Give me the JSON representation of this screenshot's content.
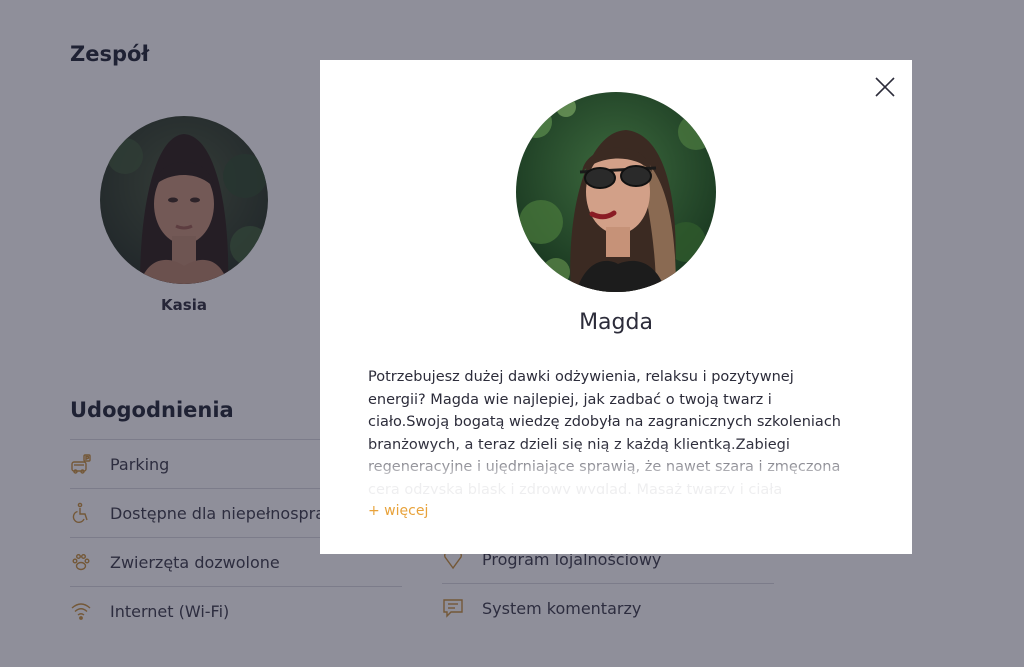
{
  "team": {
    "title": "Zespół",
    "members": [
      {
        "name": "Kasia"
      }
    ]
  },
  "amenities": {
    "title": "Udogodnienia",
    "left": [
      {
        "label": "Parking",
        "icon": "parking-icon"
      },
      {
        "label": "Dostępne dla niepełnosprawnych",
        "icon": "wheelchair-icon"
      },
      {
        "label": "Zwierzęta dozwolone",
        "icon": "paw-icon"
      },
      {
        "label": "Internet (Wi-Fi)",
        "icon": "wifi-icon"
      }
    ],
    "right": [
      {
        "label": "Program lojalnościowy",
        "icon": "heart-icon"
      },
      {
        "label": "System komentarzy",
        "icon": "comment-icon"
      }
    ]
  },
  "modal": {
    "name": "Magda",
    "bio": "Potrzebujesz dużej dawki odżywienia, relaksu i pozytywnej energii? Magda wie najlepiej, jak zadbać o twoją twarz i ciało.Swoją bogatą wiedzę zdobyła na zagranicznych szkoleniach branżowych, a teraz dzieli się nią z każdą klientką.Zabiegi regeneracyjne i ujędrniające sprawią, że nawet szara i zmęczona cera odzyska blask i zdrowy wygląd. Masaż twarzy i ciała wykonany przez Magdę jest doskonały i",
    "more_label": "+ więcej",
    "close_icon": "close-icon"
  },
  "colors": {
    "accent": "#e8a23a",
    "overlay": "rgba(31,32,54,0.5)",
    "icon": "#c8913a"
  }
}
